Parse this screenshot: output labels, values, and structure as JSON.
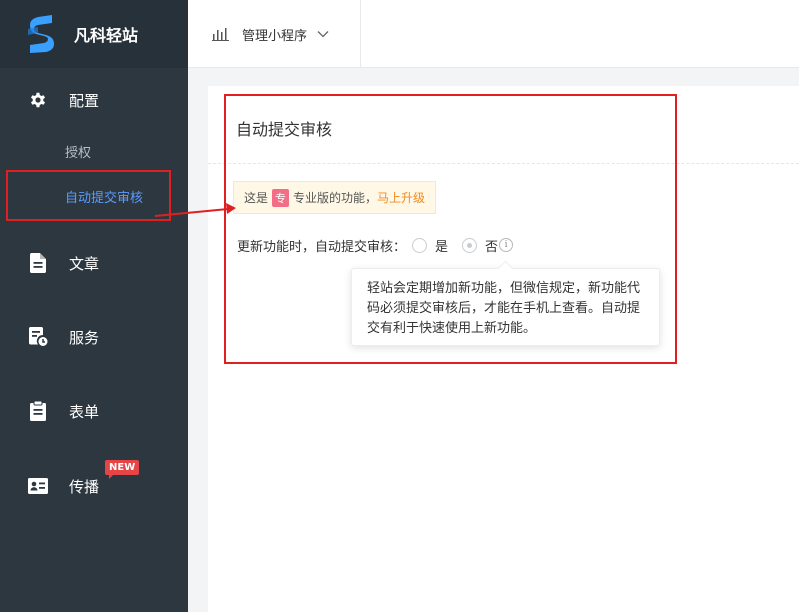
{
  "brand": {
    "name": "凡科轻站"
  },
  "topbar": {
    "app_selector": "管理小程序"
  },
  "sidebar": {
    "items": [
      {
        "label": "配置",
        "icon": "gear-icon"
      },
      {
        "label": "文章",
        "icon": "document-icon"
      },
      {
        "label": "服务",
        "icon": "service-icon"
      },
      {
        "label": "表单",
        "icon": "clipboard-icon"
      },
      {
        "label": "传播",
        "icon": "id-card-icon"
      }
    ],
    "sub_items": [
      {
        "label": "授权"
      },
      {
        "label": "自动提交审核"
      }
    ],
    "new_badge": "NEW"
  },
  "main": {
    "title": "自动提交审核",
    "notice": {
      "prefix": "这是",
      "tag": "专",
      "middle": "专业版的功能，",
      "link": "马上升级"
    },
    "setting": {
      "label": "更新功能时，自动提交审核：",
      "option_yes": "是",
      "option_no": "否",
      "selected": "否"
    },
    "tooltip": "轻站会定期增加新功能，但微信规定，新功能代码必须提交审核后，才能在手机上查看。自动提交有利于快速使用上新功能。"
  },
  "colors": {
    "sidebar_bg": "#2d3740",
    "active_link": "#5b9bff",
    "highlight": "#e02020",
    "upgrade": "#f08a24",
    "pro_tag": "#f46d86",
    "new_badge": "#e64545"
  }
}
